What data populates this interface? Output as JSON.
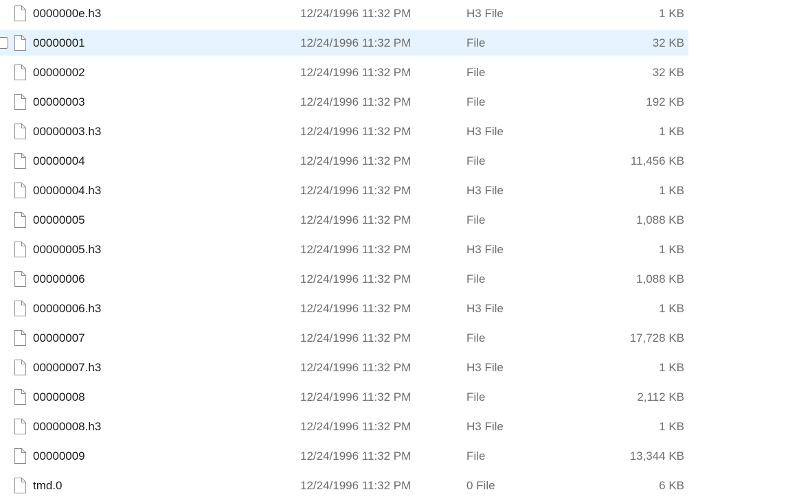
{
  "files": [
    {
      "name": "0000000e.h3",
      "date": "12/24/1996 11:32 PM",
      "type": "H3 File",
      "size": "1 KB"
    },
    {
      "name": "00000001",
      "date": "12/24/1996 11:32 PM",
      "type": "File",
      "size": "32 KB",
      "hovered": true
    },
    {
      "name": "00000002",
      "date": "12/24/1996 11:32 PM",
      "type": "File",
      "size": "32 KB"
    },
    {
      "name": "00000003",
      "date": "12/24/1996 11:32 PM",
      "type": "File",
      "size": "192 KB"
    },
    {
      "name": "00000003.h3",
      "date": "12/24/1996 11:32 PM",
      "type": "H3 File",
      "size": "1 KB"
    },
    {
      "name": "00000004",
      "date": "12/24/1996 11:32 PM",
      "type": "File",
      "size": "11,456 KB"
    },
    {
      "name": "00000004.h3",
      "date": "12/24/1996 11:32 PM",
      "type": "H3 File",
      "size": "1 KB"
    },
    {
      "name": "00000005",
      "date": "12/24/1996 11:32 PM",
      "type": "File",
      "size": "1,088 KB"
    },
    {
      "name": "00000005.h3",
      "date": "12/24/1996 11:32 PM",
      "type": "H3 File",
      "size": "1 KB"
    },
    {
      "name": "00000006",
      "date": "12/24/1996 11:32 PM",
      "type": "File",
      "size": "1,088 KB"
    },
    {
      "name": "00000006.h3",
      "date": "12/24/1996 11:32 PM",
      "type": "H3 File",
      "size": "1 KB"
    },
    {
      "name": "00000007",
      "date": "12/24/1996 11:32 PM",
      "type": "File",
      "size": "17,728 KB"
    },
    {
      "name": "00000007.h3",
      "date": "12/24/1996 11:32 PM",
      "type": "H3 File",
      "size": "1 KB"
    },
    {
      "name": "00000008",
      "date": "12/24/1996 11:32 PM",
      "type": "File",
      "size": "2,112 KB"
    },
    {
      "name": "00000008.h3",
      "date": "12/24/1996 11:32 PM",
      "type": "H3 File",
      "size": "1 KB"
    },
    {
      "name": "00000009",
      "date": "12/24/1996 11:32 PM",
      "type": "File",
      "size": "13,344 KB"
    },
    {
      "name": "tmd.0",
      "date": "12/24/1996 11:32 PM",
      "type": "0 File",
      "size": "6 KB"
    }
  ],
  "icons": {
    "file": "blank-file-icon",
    "checkbox": "row-checkbox"
  },
  "colors": {
    "hover_background": "#e5f3ff",
    "secondary_text": "#6d6d6d",
    "primary_text": "#1a1a1a"
  }
}
